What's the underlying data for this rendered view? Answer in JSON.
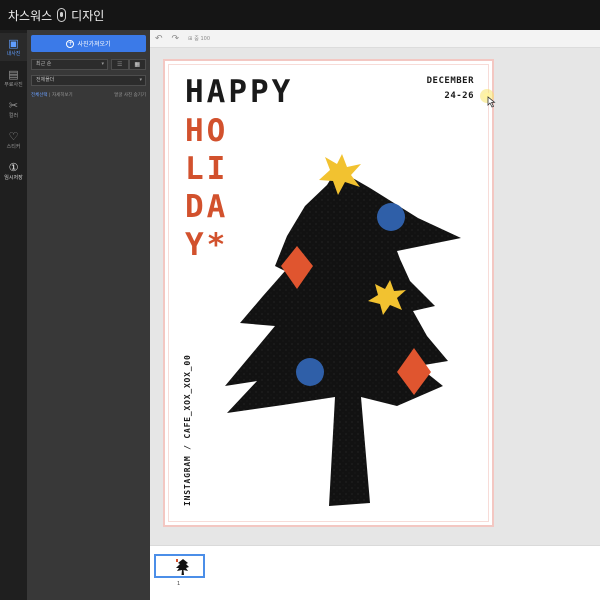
{
  "app": {
    "title_prefix": "차스워스",
    "title_suffix": "디자인"
  },
  "sidebar": {
    "items": [
      {
        "label": "내사진",
        "icon": "photo-icon",
        "active": true
      },
      {
        "label": "무료사진",
        "icon": "image-icon",
        "active": false
      },
      {
        "label": "컬러",
        "icon": "scissors-icon",
        "active": false
      },
      {
        "label": "스티커",
        "icon": "heart-icon",
        "active": false
      },
      {
        "label": "임시저장",
        "icon": "info-circle-icon",
        "active": false
      }
    ]
  },
  "panel": {
    "upload_label": "사진가져오기",
    "sort_select": "최근 순",
    "folder_select": "전체폴더",
    "left_link_blue": "전체선택",
    "left_link_gray": "| 자세히보기",
    "right_link": "얼굴 사진 숨기기",
    "view_modes": [
      "☰",
      "▦"
    ]
  },
  "toolbar": {
    "undo_icon": "undo-icon",
    "redo_icon": "redo-icon",
    "zoom_label": "줌 100"
  },
  "poster": {
    "happy": "HAPPY",
    "holiday_lines": [
      "HO",
      "LI",
      "DA",
      "Y*"
    ],
    "date_month": "DECEMBER",
    "date_days": "24-26",
    "instagram": "INSTAGRAM / CAFE_XOX_XOX_00",
    "colors": {
      "black": "#1a1a1a",
      "orange": "#d2512d",
      "yellow": "#f2c230",
      "blue": "#2f5fa8",
      "diamond": "#e0552f"
    }
  },
  "filmstrip": {
    "page_number": "1"
  }
}
